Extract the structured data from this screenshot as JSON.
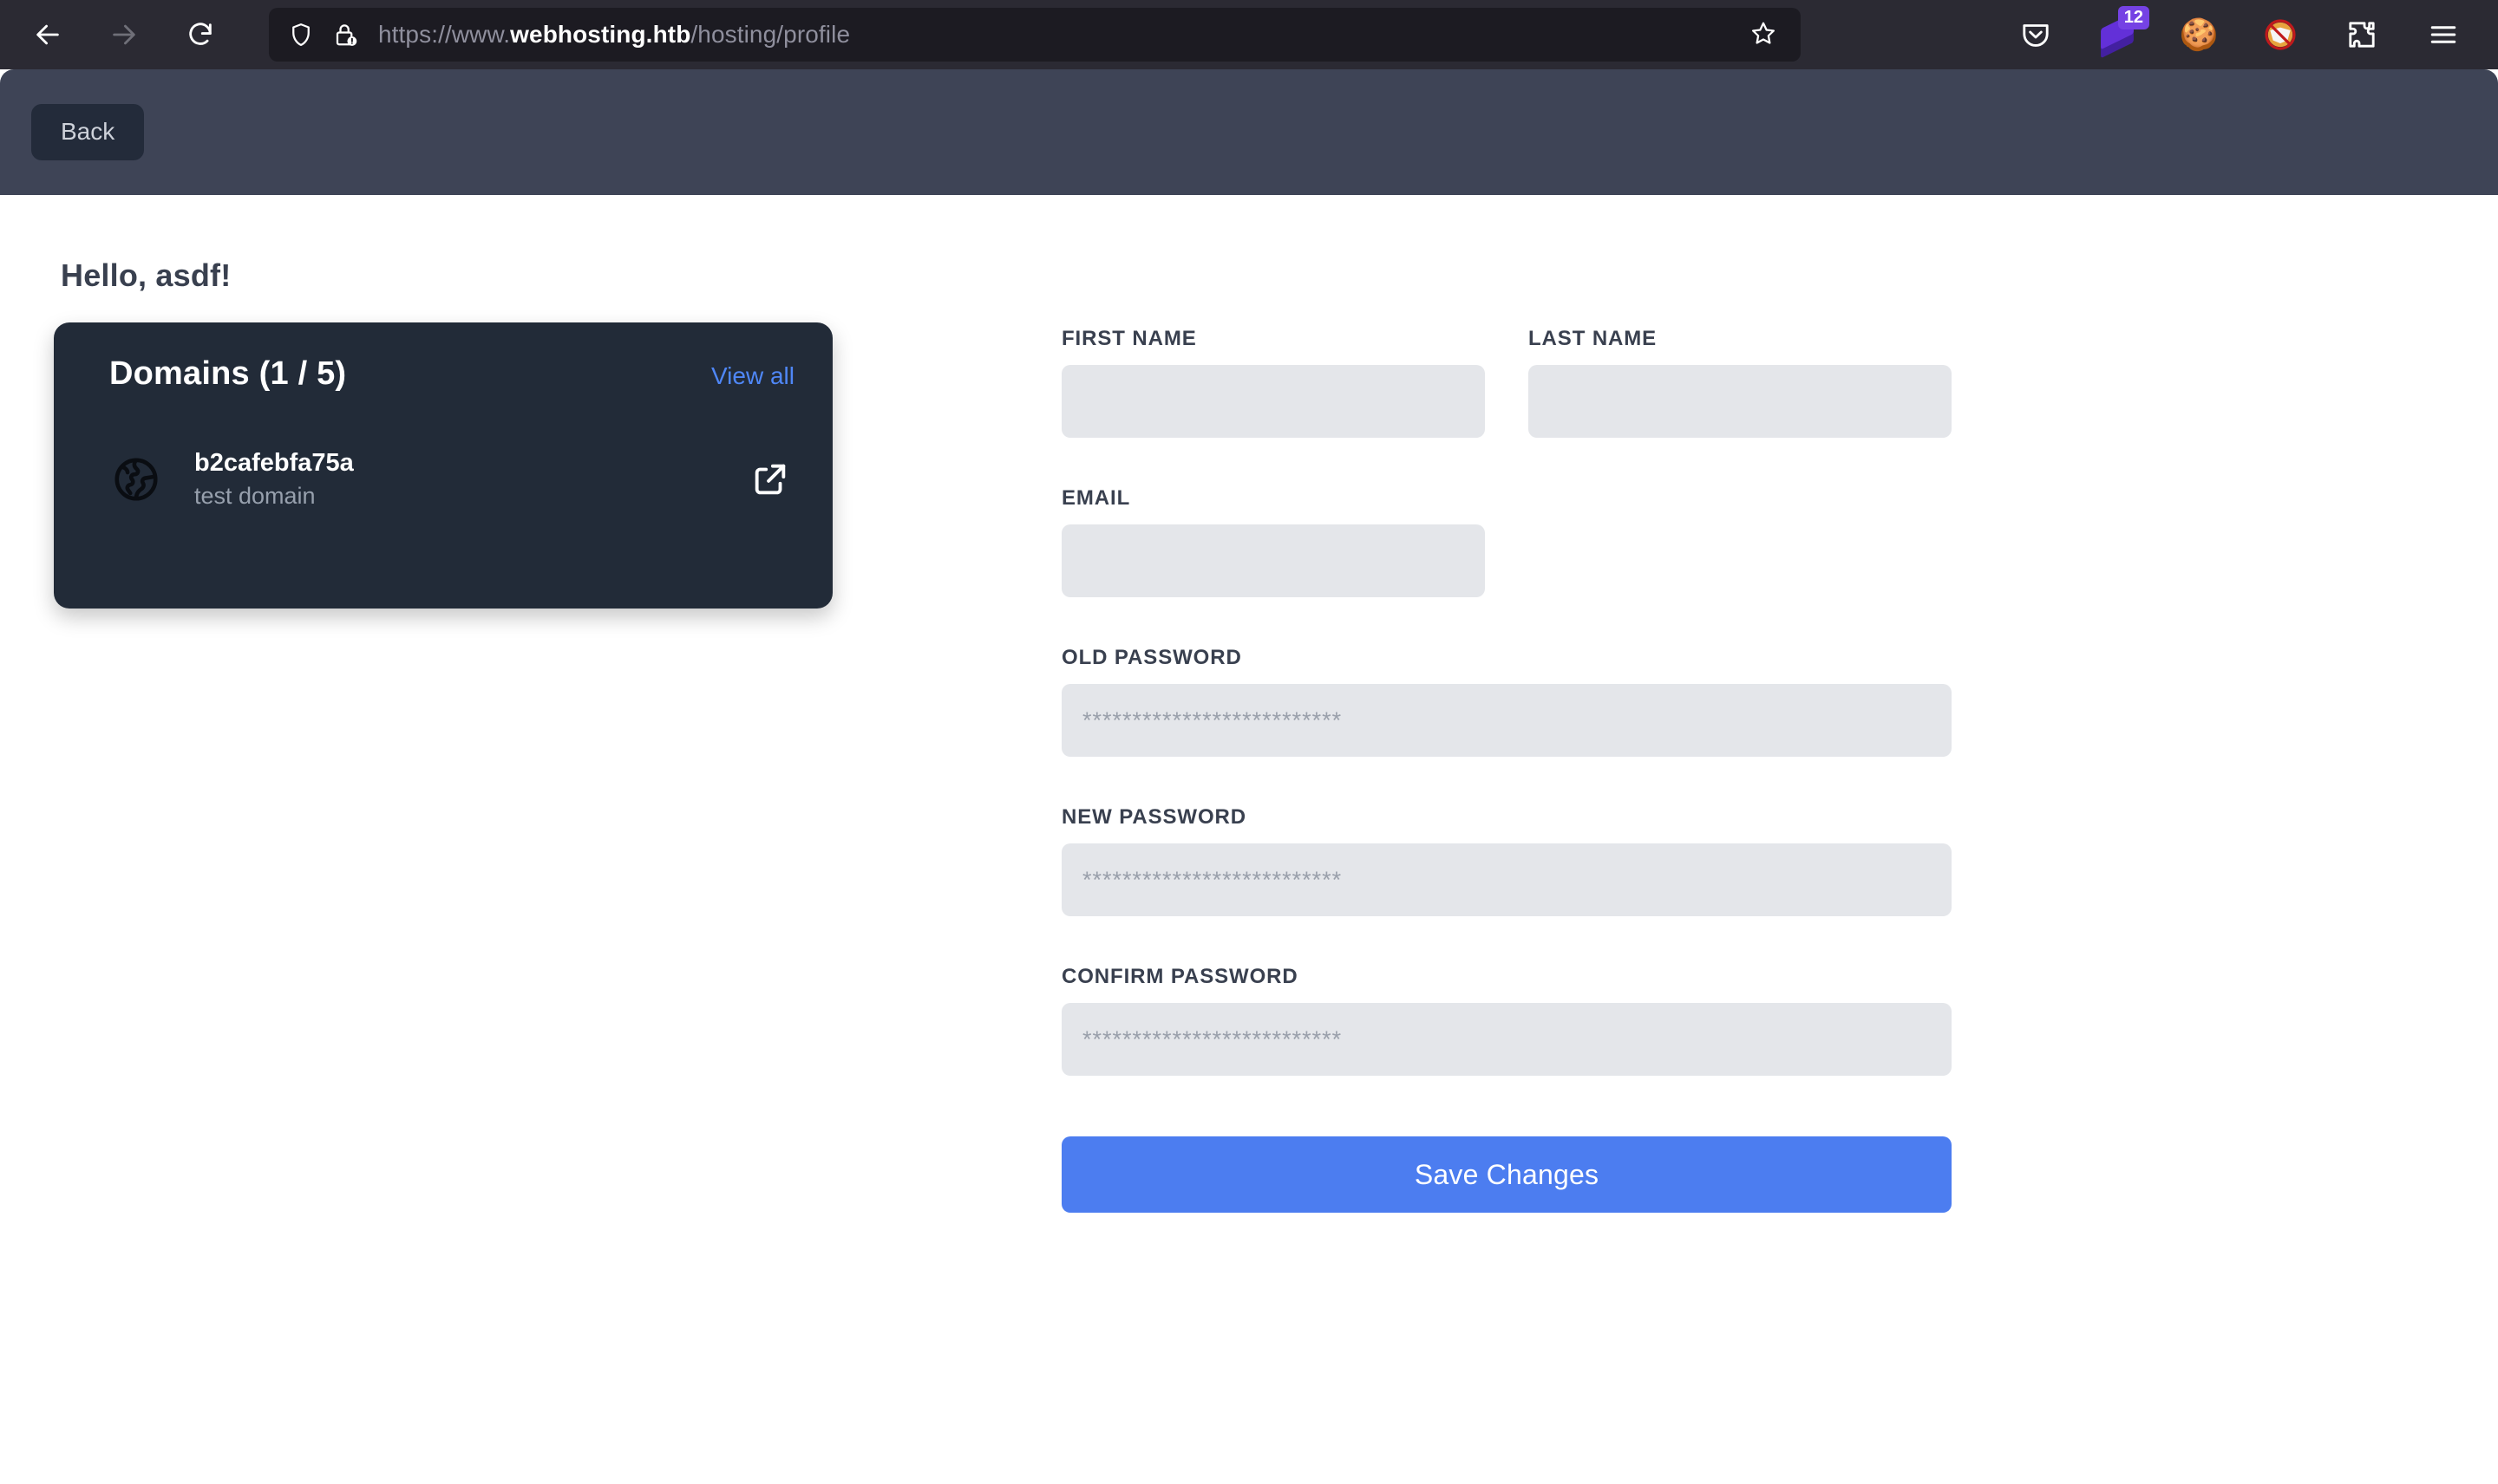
{
  "browser": {
    "back_icon": "arrow-left-icon",
    "forward_icon": "arrow-right-icon",
    "reload_icon": "reload-icon",
    "shield_icon": "shield-icon",
    "lock_warning_icon": "lock-warning-icon",
    "bookmark_icon": "star-icon",
    "url_prefix": "https://www.",
    "url_host": "webhosting.htb",
    "url_path": "/hosting/profile",
    "full_url": "https://www.webhosting.htb/hosting/profile",
    "toolbar_icons": [
      {
        "name": "pocket-icon",
        "glyph": ""
      },
      {
        "name": "layers-extension-icon",
        "glyph": "",
        "badge": "12"
      },
      {
        "name": "cookie-extension-icon",
        "glyph": "🍪"
      },
      {
        "name": "no-fox-extension-icon",
        "glyph": "🚫"
      },
      {
        "name": "puzzle-extensions-icon",
        "glyph": ""
      },
      {
        "name": "hamburger-menu-icon",
        "glyph": ""
      }
    ]
  },
  "navbar": {
    "back_label": "Back",
    "background": "#3e4456",
    "button_background": "#232b3a"
  },
  "page": {
    "greeting": "Hello, asdf!"
  },
  "domains_card": {
    "title": "Domains (1 / 5)",
    "view_all_label": "View all",
    "accent": "#4f87f7",
    "background": "#222b38",
    "items": [
      {
        "icon": "globe-icon",
        "name": "b2cafebfa75a",
        "description": "test domain",
        "action_icon": "external-link-icon"
      }
    ]
  },
  "profile_form": {
    "fields": [
      {
        "label": "FIRST NAME",
        "value": "",
        "placeholder": ""
      },
      {
        "label": "LAST NAME",
        "value": "",
        "placeholder": ""
      },
      {
        "label": "EMAIL",
        "value": "",
        "placeholder": ""
      },
      {
        "label": "OLD PASSWORD",
        "value": "",
        "placeholder": "**************************"
      },
      {
        "label": "NEW PASSWORD",
        "value": "",
        "placeholder": "**************************"
      },
      {
        "label": "CONFIRM PASSWORD",
        "value": "",
        "placeholder": "**************************"
      }
    ],
    "submit_label": "Save Changes",
    "submit_color": "#4c7df0",
    "input_background": "#e4e6ea"
  }
}
